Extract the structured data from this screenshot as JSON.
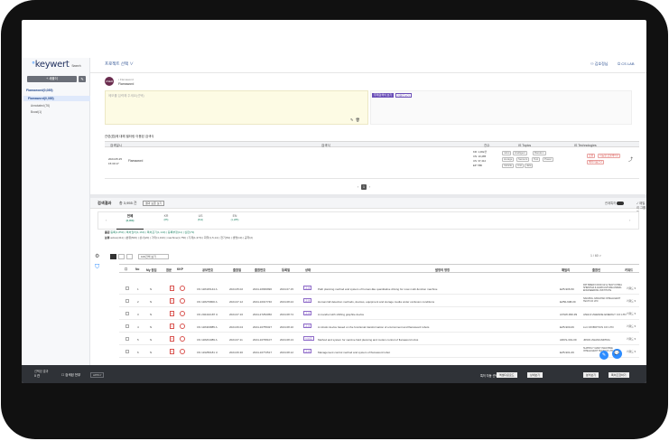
{
  "app": {
    "logo": "keywert",
    "logo_sub": "Search"
  },
  "sidebar": {
    "new_button": "+ 새폴더",
    "root": "Flamaword(0,085)",
    "selected": "Flamaword(0,085)",
    "items": [
      "Annotated (76)",
      "Boost(1)"
    ]
  },
  "topnav": {
    "project": "프로젝트 선택 ∨",
    "user": "김호정님",
    "logout": "CS LAB"
  },
  "memo": {
    "avatar": "USER",
    "owner": "Flamaword",
    "name": "Flamaword",
    "placeholder": "메모를 입력해 주세요(선택)",
    "tag1": "주제검색식 보기",
    "tag2": "키워드보기"
  },
  "query_section": {
    "title": "관련(법)에 대해 필터링 이용된 검색식",
    "headers": [
      "검색일시",
      "검색식",
      "건수",
      "IS Topics",
      "IS Technologies"
    ],
    "row": {
      "date": "2024.05.25",
      "time": "15:30:17",
      "term": "Flamaword",
      "counts": [
        "KR: 1,062건",
        "CN: 10,285",
        "US: 37,412",
        "EP: 586"
      ],
      "topics": [
        "robot",
        "intelligent",
        "Random",
        "storage",
        "Sensors",
        "Test",
        "Power",
        "Vehicle",
        "Unit",
        "data"
      ],
      "techs": [
        "로봇",
        "지능형 로봇제어기",
        "배터리충전기"
      ]
    },
    "page": "1"
  },
  "results": {
    "title": "검색결과",
    "count": "총 3,955 건",
    "button": "결과 보존 보기",
    "toggle_label": "관계특허",
    "group_label": "패밀리 그룹핑",
    "tabs": [
      {
        "label": "전체",
        "count": "(2,453)"
      },
      {
        "label": "KR",
        "count": "(85)"
      },
      {
        "label": "US",
        "count": "(811)"
      },
      {
        "label": "EN",
        "count": "(1,285)"
      }
    ],
    "filter1_label": "출원",
    "filter1_text": "등록(1,853) | 특허권리(1,160) | 특허포기(1,140) | 등록부정(11) | 심판(79)",
    "filter2_label": "분류",
    "filter2_text": "active(411) | 분류(500) | 상사(20) | 기타(1,310) | machine(1,750) | 기계(1,370) | 화학(1,5,14) | 전기(54) | 생명(13) | 공학(2)",
    "per_page": "100건씩 보기",
    "pager": "1 / 60 >"
  },
  "patent_table": {
    "headers": [
      "No",
      "My 점검",
      "원문",
      "KKP",
      "공보번호",
      "출원일",
      "출원번호",
      "등록일",
      "상태",
      "발명의 명칭",
      "패밀리",
      "출원인",
      "키워드"
    ],
    "rows": [
      {
        "no": "1",
        "my": "N",
        "pub": "CN 118415144 A",
        "appdate": "2024.05.02",
        "appno": "2024-10666996",
        "regdate": "2024.07.15",
        "status": "공개",
        "title": "Path planning method and system of human-like quantitative driving for mow multi-function machine",
        "family": "EZ5-906-50",
        "applicant": "PAT BREW FOOD UZ & TECH CHINA SHENHUA & AGRICULTURE ANIMAL ENGINEERING INSTITUTE",
        "kw": "키워드 ▾"
      },
      {
        "no": "2",
        "my": "N",
        "pub": "CN 118279800 A",
        "appdate": "2024.07.12",
        "appno": "2024-10017740",
        "regdate": "2024.08.24",
        "status": "공개",
        "title": "Human fall detection methods, devices, equipment and storage media under occlusion conditions",
        "family": "EZ50-908-09",
        "applicant": "NANJING JIANGHAN INTELLIGENT TECH CO LTD",
        "kw": "키워드 ▾"
      },
      {
        "no": "3",
        "my": "N",
        "pub": "CN 202410187 U",
        "appdate": "2024.07.16",
        "appno": "2024-27252050",
        "regdate": "2024.08.74",
        "status": "공개",
        "title": "A mandrel with shifting graphite device",
        "family": "AXSW-999-99",
        "applicant": "ANHUI ZHENDE ENERGY CO LTD",
        "kw": "키워드 ▾"
      },
      {
        "no": "4",
        "my": "N",
        "pub": "CN 118403885 A",
        "appdate": "2024.06.04",
        "appno": "2024-10755327",
        "regdate": "2024.08.10",
        "status": "공개",
        "title": "A robotic device based on the functional transformation of environment and flamaword robots",
        "family": "EZ5-900-09",
        "applicant": "LLC ROBOTICS CO LTD",
        "kw": "키워드 ▾"
      },
      {
        "no": "5",
        "my": "N",
        "pub": "CN 118201089 A",
        "appdate": "2024.07.11",
        "appno": "2024-10795107",
        "regdate": "2024.08.13",
        "status": "심사중",
        "title": "Method and system for vaccine field planning and motion control of flamaword robot",
        "family": "ADKS-301-09",
        "applicant": "JIPAN ZHANGSIPING",
        "kw": "키워드 ▾"
      },
      {
        "no": "6",
        "my": "N",
        "pub": "CN 119256181 U",
        "appdate": "2024.06.30",
        "appno": "2024-10772517",
        "regdate": "2024.08.12",
        "status": "공개",
        "title": "Management control method and system of flamaword robot",
        "family": "EZ5-901-09",
        "applicant": "SUZHOU YUANYI MACHINE INTELLIGENT TECH CO LTD",
        "kw": "키워드 ▾"
      }
    ]
  },
  "bottom": {
    "selected_label": "선택된 결과",
    "selected_count": "0 건",
    "select_all": "검색된 전부",
    "apply": "APPLY",
    "export_label": "특허 자동 선택",
    "btn1": "엑셀다운로드",
    "btn2": "상세보기",
    "btn3": "분석보기",
    "btn4": "특허조합하기"
  },
  "colors": {
    "accent": "#2d8cff",
    "brand_dark": "#1d2d5c",
    "tag_purple": "#6b4fb8",
    "highlight": "#e67e22"
  }
}
